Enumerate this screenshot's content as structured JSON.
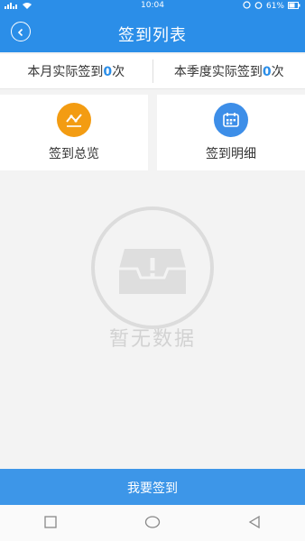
{
  "status_bar": {
    "time": "10:04",
    "battery": "61%"
  },
  "header": {
    "title": "签到列表"
  },
  "stats": {
    "month_label": "本月实际签到",
    "month_value": "0",
    "month_unit": "次",
    "quarter_label": "本季度实际签到",
    "quarter_value": "0",
    "quarter_unit": "次"
  },
  "cards": [
    {
      "label": "签到总览",
      "icon": "chart-icon",
      "color": "#f39c12"
    },
    {
      "label": "签到明细",
      "icon": "calendar-icon",
      "color": "#3d8ee8"
    }
  ],
  "empty_state": {
    "text": "暂无数据"
  },
  "checkin_button": {
    "label": "我要签到"
  }
}
